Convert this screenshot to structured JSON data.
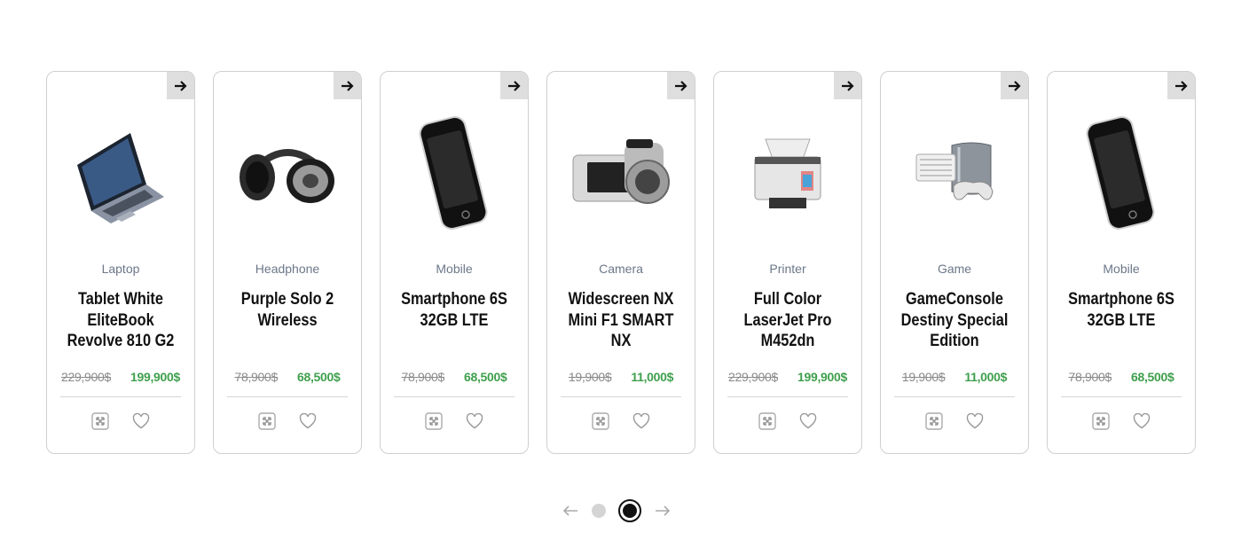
{
  "products": [
    {
      "category": "Laptop",
      "title": "Tablet White EliteBook Revolve 810 G2",
      "old_price": "229,900$",
      "new_price": "199,900$",
      "image_icon": "laptop-image"
    },
    {
      "category": "Headphone",
      "title": "Purple Solo 2 Wireless",
      "old_price": "78,900$",
      "new_price": "68,500$",
      "image_icon": "headphones-image"
    },
    {
      "category": "Mobile",
      "title": "Smartphone 6S 32GB LTE",
      "old_price": "78,900$",
      "new_price": "68,500$",
      "image_icon": "smartphone-image"
    },
    {
      "category": "Camera",
      "title": "Widescreen NX Mini F1 SMART NX",
      "old_price": "19,900$",
      "new_price": "11,000$",
      "image_icon": "camera-image"
    },
    {
      "category": "Printer",
      "title": "Full Color LaserJet Pro M452dn",
      "old_price": "229,900$",
      "new_price": "199,900$",
      "image_icon": "printer-image"
    },
    {
      "category": "Game",
      "title": "GameConsole Destiny Special Edition",
      "old_price": "19,900$",
      "new_price": "11,000$",
      "image_icon": "game-console-image"
    },
    {
      "category": "Mobile",
      "title": "Smartphone 6S 32GB LTE",
      "old_price": "78,900$",
      "new_price": "68,500$",
      "image_icon": "smartphone-image"
    }
  ],
  "pagination": {
    "pages": 2,
    "active_page": 2
  },
  "colors": {
    "new_price": "#3f9f4d",
    "old_price": "#8a8a8a",
    "category": "#6b7788",
    "arrow_bg": "#dedede"
  }
}
